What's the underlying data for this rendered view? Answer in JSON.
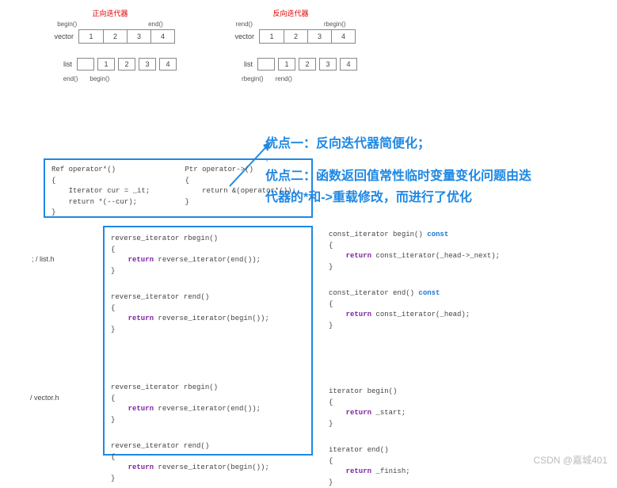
{
  "top_diagram": {
    "forward": {
      "title": "正向迭代器",
      "begin": "begin()",
      "end": "end()",
      "vector_label": "vector",
      "vector_cells": [
        "1",
        "2",
        "3",
        "4"
      ],
      "list_label": "list",
      "list_cells": [
        "",
        "1",
        "2",
        "3",
        "4"
      ],
      "sub_left": "end()",
      "sub_right": "begin()"
    },
    "reverse": {
      "title": "反向迭代器",
      "rend": "rend()",
      "rbegin": "rbegin()",
      "vector_label": "vector",
      "vector_cells": [
        "1",
        "2",
        "3",
        "4"
      ],
      "list_label": "list",
      "list_cells": [
        "",
        "1",
        "2",
        "3",
        "4"
      ],
      "sub_left": "rbegin()",
      "sub_right": "rend()"
    }
  },
  "annotation": {
    "line1": "优点一：反向迭代器简便化；",
    "dot": "·",
    "line2": "优点二：函数返回值常性临时变量变化问题由迭",
    "line3": "代器的*和->重载修改，而进行了优化"
  },
  "box_top": {
    "left": {
      "sig": "Ref operator*()",
      "l1": "{",
      "l2": "    Iterator cur = _it;",
      "l3": "    return *(--cur);",
      "l4": "}"
    },
    "right": {
      "sig": "Ptr operator->()",
      "l1": "{",
      "l2": "    return &(operator*());",
      "l3": "}"
    }
  },
  "box_bottom": {
    "rb1": {
      "sig": "reverse_iterator rbegin()",
      "l1": "{",
      "ret": "    return",
      "val": " reverse_iterator(end());",
      "l3": "}"
    },
    "rb2": {
      "sig": "reverse_iterator rend()",
      "l1": "{",
      "ret": "    return",
      "val": " reverse_iterator(begin());",
      "l3": "}"
    },
    "rb3": {
      "sig": "reverse_iterator rbegin()",
      "l1": "{",
      "ret": "    return",
      "val": " reverse_iterator(end());",
      "l3": "}"
    },
    "rb4": {
      "sig": "reverse_iterator rend()",
      "l1": "{",
      "ret": "    return",
      "val": " reverse_iterator(begin());",
      "l3": "}"
    }
  },
  "right_code": {
    "cb1": {
      "sig": "const_iterator begin()",
      "const": " const",
      "l1": "{",
      "ret": "    return",
      "val": " const_iterator(_head->_next);",
      "l3": "}"
    },
    "cb2": {
      "sig": "const_iterator end()",
      "const": " const",
      "l1": "{",
      "ret": "    return",
      "val": " const_iterator(_head);",
      "l3": "}"
    },
    "cb3": {
      "sig": "iterator begin()",
      "l1": "{",
      "ret": "    return",
      "val": " _start;",
      "l3": "}"
    },
    "cb4": {
      "sig": "iterator end()",
      "l1": "{",
      "ret": "    return",
      "val": " _finish;",
      "l3": "}"
    }
  },
  "files": {
    "listh": "; / list.h",
    "vectorh": "/ vector.h"
  },
  "watermark": "CSDN @嘉城401"
}
